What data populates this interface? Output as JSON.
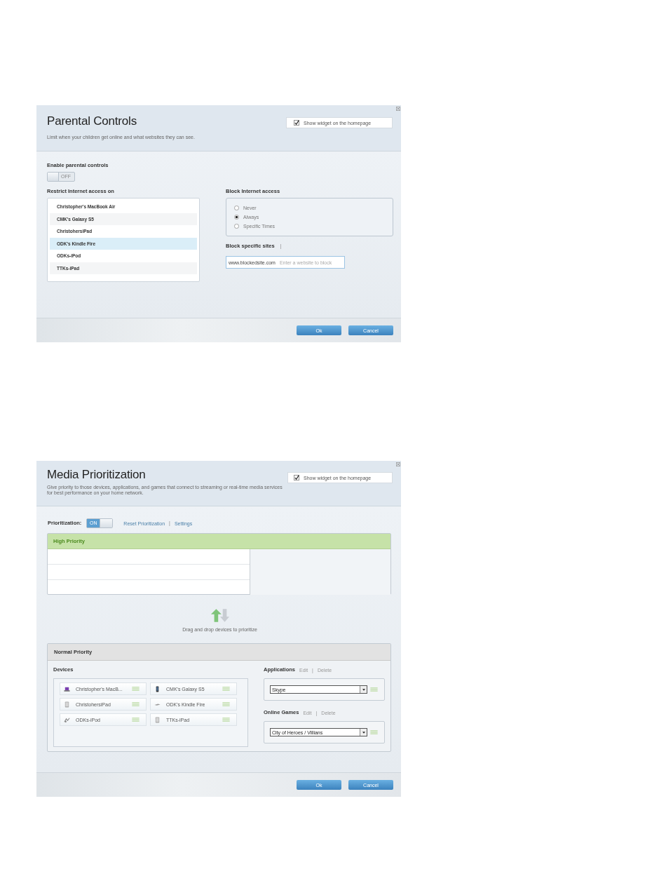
{
  "parental_controls": {
    "title": "Parental Controls",
    "description": "Limit when your children get online and what websites they can see.",
    "widget_checkbox": {
      "label": "Show widget on the homepage",
      "checked": true
    },
    "enable": {
      "label": "Enable parental controls",
      "toggle": {
        "label": "OFF",
        "on": false
      }
    },
    "restrict": {
      "label": "Restrict Internet access on",
      "devices": [
        {
          "name": "Christopher's MacBook Air",
          "selected": false
        },
        {
          "name": "CMK's Galaxy S5",
          "selected": false
        },
        {
          "name": "ChristohersiPad",
          "selected": false
        },
        {
          "name": "ODK's Kindle Fire",
          "selected": true
        },
        {
          "name": "ODKs-iPod",
          "selected": false
        },
        {
          "name": "TTKs-iPad",
          "selected": false
        }
      ]
    },
    "block_access": {
      "label": "Block Internet access",
      "options": [
        {
          "label": "Never",
          "selected": false
        },
        {
          "label": "Always",
          "selected": true
        },
        {
          "label": "Specific Times",
          "selected": false
        }
      ]
    },
    "block_sites": {
      "label": "Block specific sites",
      "separator": "|",
      "value": "www.blockedsite.com",
      "placeholder": "Enter a website to block"
    },
    "buttons": [
      "Ok",
      "Cancel"
    ]
  },
  "media_prioritization": {
    "title": "Media Prioritization",
    "description": "Give priority to those devices, applications, and games that connect to streaming or real-time media services for best performance on your home network.",
    "widget_checkbox": {
      "label": "Show widget on the homepage",
      "checked": true
    },
    "prioritization": {
      "label": "Prioritization:",
      "toggle": {
        "label": "ON",
        "on": true
      },
      "links": [
        "Reset Prioritization",
        "Settings"
      ],
      "separator": "|"
    },
    "high_priority": {
      "title": "High Priority"
    },
    "drag_hint": "Drag and drop devices to prioritize",
    "normal_priority": {
      "title": "Normal Priority",
      "devices": {
        "label": "Devices",
        "items": [
          {
            "name": "Christopher's MacB...",
            "kind": "laptop"
          },
          {
            "name": "CMK's Galaxy S5",
            "kind": "phone"
          },
          {
            "name": "ChristohersiPad",
            "kind": "tablet"
          },
          {
            "name": "ODK's Kindle Fire",
            "kind": "ereader"
          },
          {
            "name": "ODKs-iPod",
            "kind": "player"
          },
          {
            "name": "TTKs-iPad",
            "kind": "tablet"
          }
        ]
      },
      "applications": {
        "label": "Applications",
        "actions": [
          "Edit",
          "Delete"
        ],
        "separator": "|",
        "value": "Skype"
      },
      "online_games": {
        "label": "Online Games",
        "actions": [
          "Edit",
          "Delete"
        ],
        "separator": "|",
        "value": "City of Heroes / Villians"
      }
    },
    "buttons": [
      "Ok",
      "Cancel"
    ]
  }
}
